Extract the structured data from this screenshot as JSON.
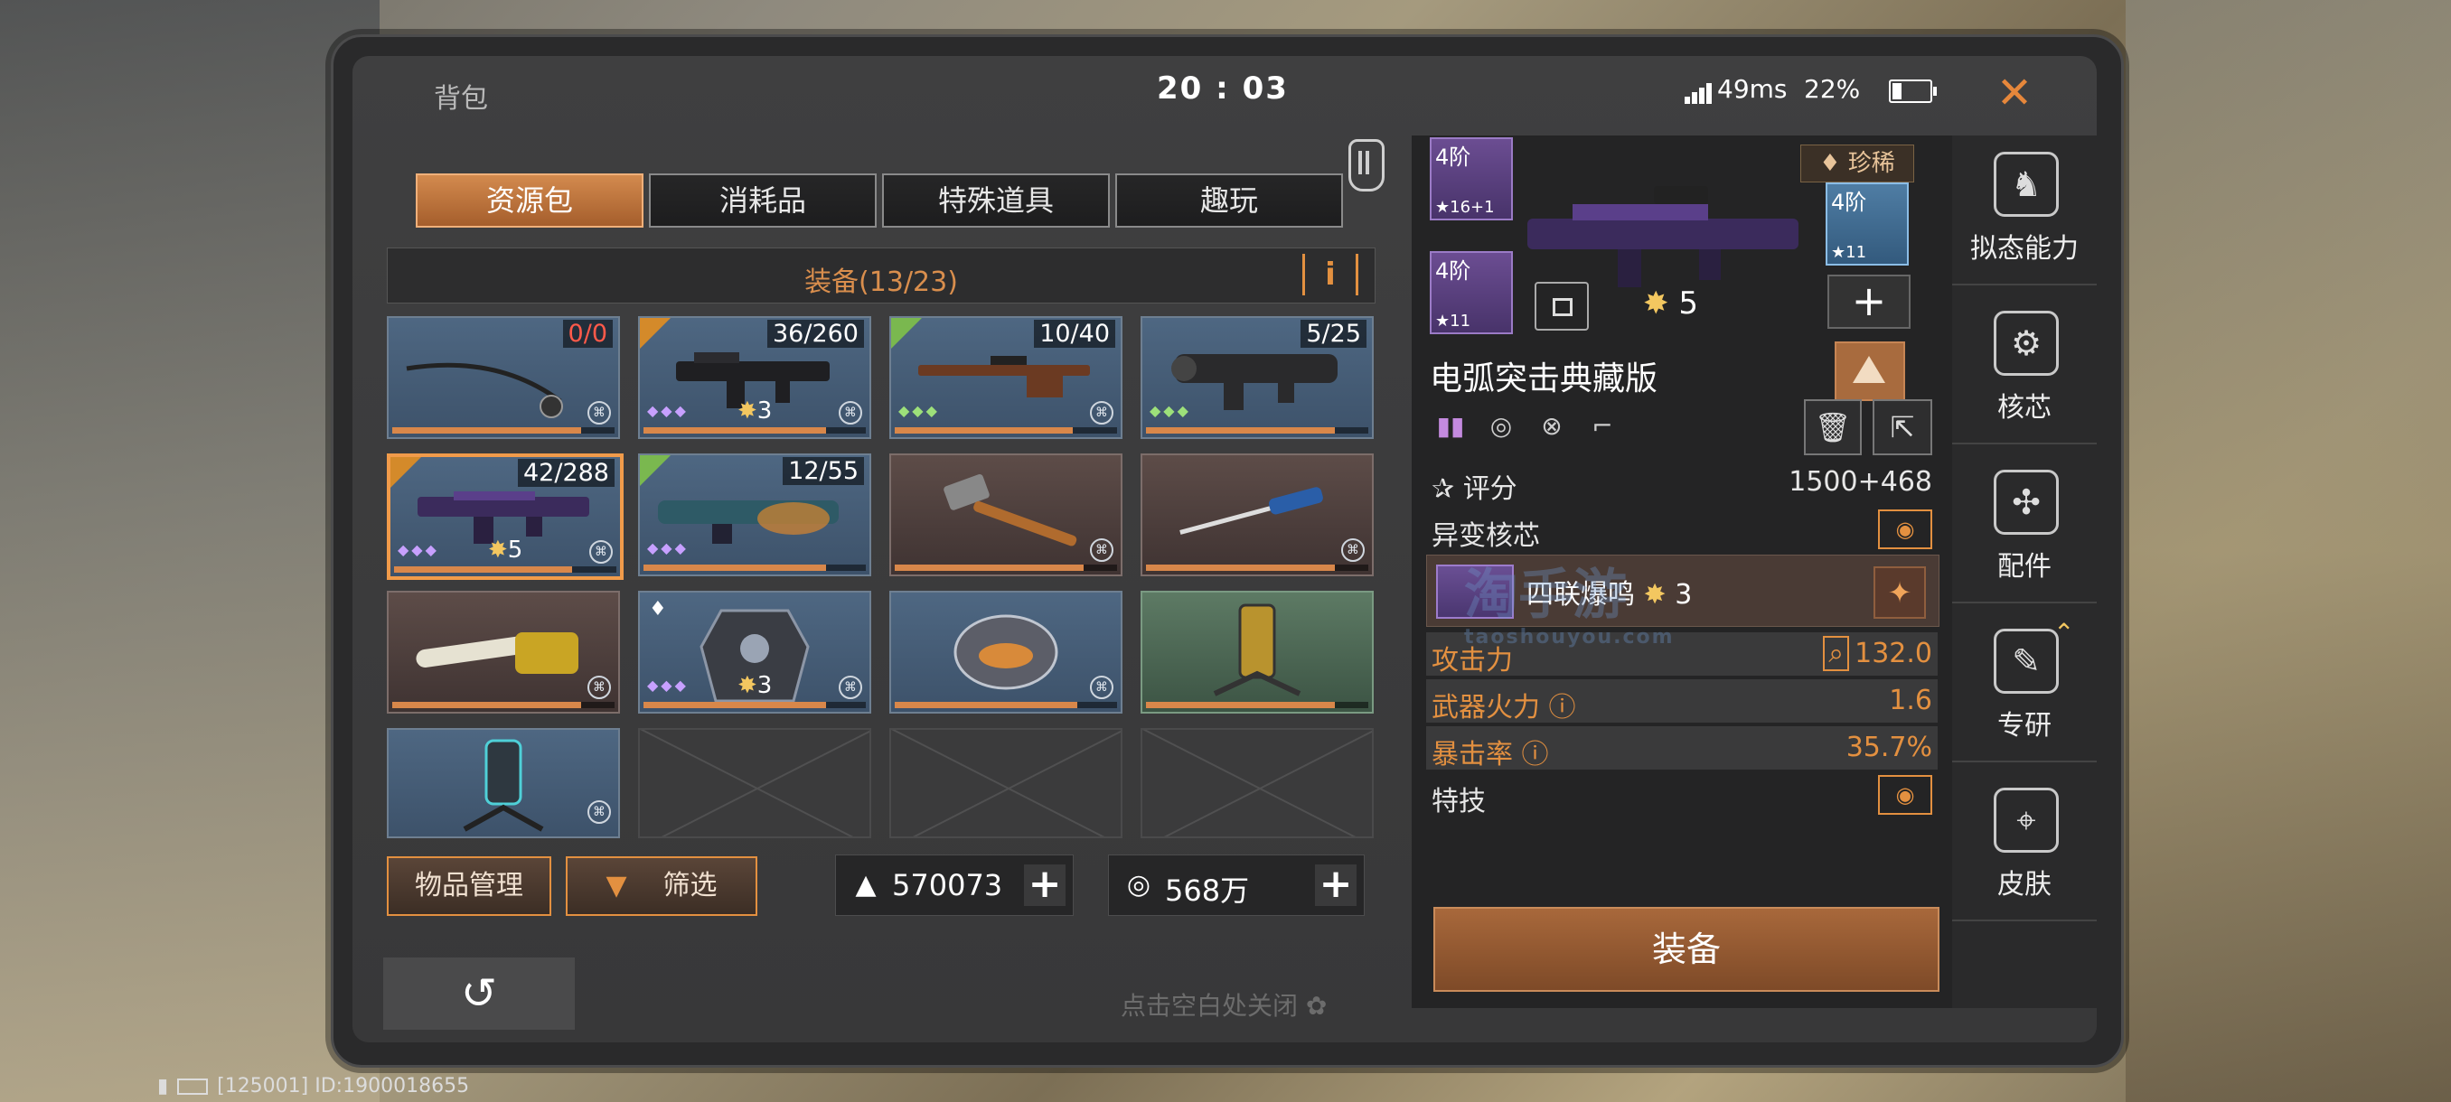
{
  "header": {
    "title": "背包",
    "clock": "20 : 03",
    "ping": "49ms",
    "battery": "22%",
    "close_icon": "close-icon"
  },
  "tabs": [
    {
      "label": "资源包",
      "active": true
    },
    {
      "label": "消耗品",
      "active": false
    },
    {
      "label": "特殊道具",
      "active": false
    },
    {
      "label": "趣玩",
      "active": false
    }
  ],
  "equipment": {
    "title": "装备(13/23)",
    "info": "i"
  },
  "items": [
    {
      "name": "fishing-rod",
      "count": "0/0",
      "progress": 0.85,
      "stars": "",
      "level": ""
    },
    {
      "name": "assault-rifle",
      "count": "36/260",
      "progress": 0.82,
      "stars": "◆◆◆",
      "level": "3"
    },
    {
      "name": "sniper-rifle",
      "count": "10/40",
      "progress": 0.8,
      "stars": "◆◆◆",
      "level": ""
    },
    {
      "name": "rocket-launcher",
      "count": "5/25",
      "progress": 0.85,
      "stars": "◆◆◆",
      "level": ""
    },
    {
      "name": "arc-assault-rifle",
      "count": "42/288",
      "progress": 0.8,
      "stars": "◆◆◆",
      "level": "5"
    },
    {
      "name": "flame-gun",
      "count": "12/55",
      "progress": 0.82,
      "stars": "◆◆◆",
      "level": ""
    },
    {
      "name": "hammer",
      "count": "",
      "progress": 0.85,
      "stars": "",
      "level": ""
    },
    {
      "name": "screwdriver",
      "count": "",
      "progress": 0.85,
      "stars": "",
      "level": ""
    },
    {
      "name": "chainsaw",
      "count": "",
      "progress": 0.85,
      "stars": "",
      "level": ""
    },
    {
      "name": "armor-suit",
      "count": "",
      "progress": 0.82,
      "stars": "◆◆◆",
      "level": "3"
    },
    {
      "name": "helmet",
      "count": "",
      "progress": 0.82,
      "stars": "",
      "level": ""
    },
    {
      "name": "totem-device",
      "count": "",
      "progress": 0.85,
      "stars": "",
      "level": ""
    },
    {
      "name": "beacon-device",
      "count": "",
      "progress": 0.0,
      "stars": "",
      "level": ""
    }
  ],
  "bottom": {
    "manage": "物品管理",
    "filter": "筛选",
    "currency1": "570073",
    "currency2": "568万"
  },
  "footer": {
    "tap_close": "点击空白处关闭",
    "id_text": "[125001] ID:1900018655"
  },
  "detail": {
    "slot1_tier": "4阶",
    "slot1_stars": "★16+1",
    "slot2_tier": "4阶",
    "slot2_stars": "★11",
    "slot3_tier": "4阶",
    "slot3_stars": "★11",
    "rarity": "珍稀",
    "star_level": "5",
    "weapon_name": "电弧突击典藏版",
    "score_label": "评分",
    "score_value": "1500+468",
    "mutation_label": "异变核芯",
    "core_name": "四联爆鸣",
    "core_level": "3",
    "stats": [
      {
        "label": "攻击力",
        "value": "132.0"
      },
      {
        "label": "武器火力",
        "value": "1.6"
      },
      {
        "label": "暴击率",
        "value": "35.7%"
      }
    ],
    "skill_label": "特技",
    "equip_button": "装备"
  },
  "sidebar": [
    {
      "label": "拟态能力",
      "icon": "mimic-icon"
    },
    {
      "label": "核芯",
      "icon": "core-icon"
    },
    {
      "label": "配件",
      "icon": "parts-icon"
    },
    {
      "label": "专研",
      "icon": "research-icon"
    },
    {
      "label": "皮肤",
      "icon": "skin-icon"
    }
  ],
  "watermark": {
    "main": "淘手游",
    "sub": "taoshouyou.com"
  }
}
